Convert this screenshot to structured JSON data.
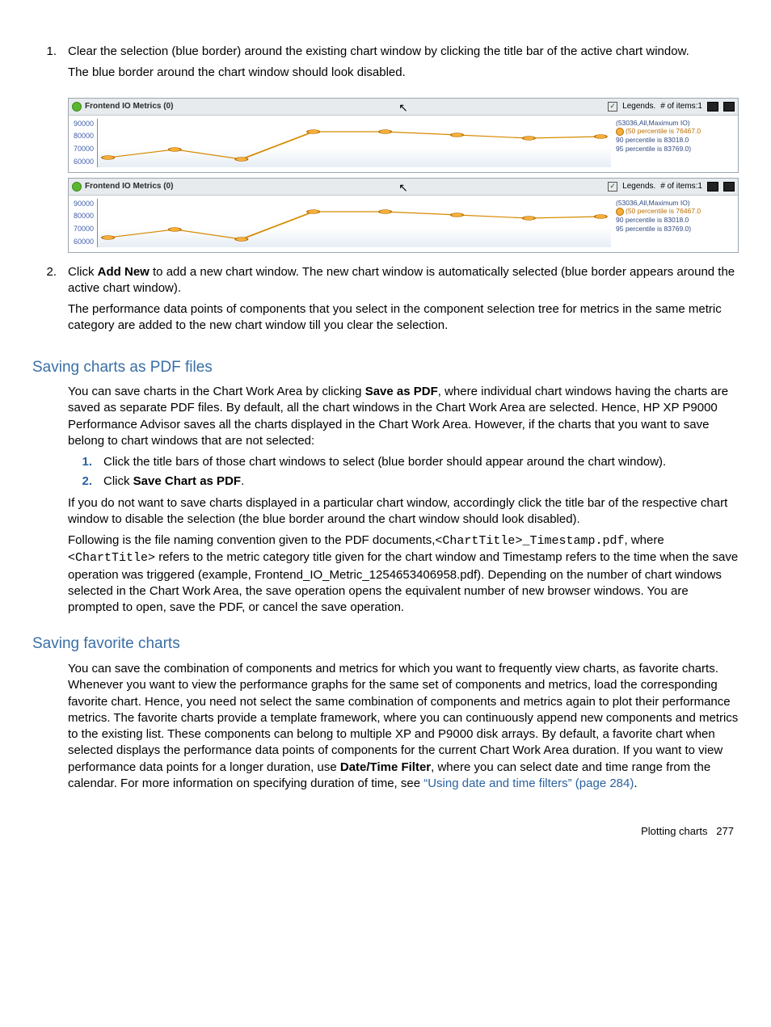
{
  "step1": {
    "num": "1.",
    "text": "Clear the selection (blue border) around the existing chart window by clicking the title bar of the active chart window.",
    "text2": "The blue border around the chart window should look disabled."
  },
  "chart_windows": [
    {
      "title": "Frontend IO Metrics (0)",
      "legends_label": "Legends.",
      "items_label": "# of items:1",
      "y_ticks": [
        "90000",
        "80000",
        "70000",
        "60000"
      ],
      "legend": {
        "series": "(53036,All,Maximum IO)",
        "p50": "(50 percentile is 76467.0",
        "p90": "90 percentile is 83018.0",
        "p95": "95 percentile is 83769.0)"
      }
    },
    {
      "title": "Frontend IO Metrics (0)",
      "legends_label": "Legends.",
      "items_label": "# of items:1",
      "y_ticks": [
        "90000",
        "80000",
        "70000",
        "60000"
      ],
      "legend": {
        "series": "(53036,All,Maximum IO)",
        "p50": "(50 percentile is 76467.0",
        "p90": "90 percentile is 83018.0",
        "p95": "95 percentile is 83769.0)"
      }
    }
  ],
  "step2": {
    "num": "2.",
    "text_before": "Click ",
    "bold": "Add New",
    "text_after": " to add a new chart window. The new chart window is automatically selected (blue border appears around the active chart window).",
    "text2": "The performance data points of components that you select in the component selection tree for metrics in the same metric category are added to the new chart window till you clear the selection."
  },
  "pdf_section": {
    "heading": "Saving charts as PDF files",
    "p1_a": "You can save charts in the Chart Work Area by clicking ",
    "p1_bold": "Save as PDF",
    "p1_b": ", where individual chart windows having the charts are saved as separate PDF files. By default, all the chart windows in the Chart Work Area are selected. Hence, HP XP P9000 Performance Advisor saves all the charts displayed in the Chart Work Area. However, if the charts that you want to save belong to chart windows that are not selected:",
    "li1": {
      "num": "1.",
      "text": "Click the title bars of those chart windows to select (blue border should appear around the chart window)."
    },
    "li2": {
      "num": "2.",
      "text_a": "Click ",
      "bold": "Save Chart as PDF",
      "text_b": "."
    },
    "p3": "If you do not want to save charts displayed in a particular chart window, accordingly click the title bar of the respective chart window to disable the selection (the blue border around the chart window should look disabled).",
    "p4_a": "Following is the file naming convention given to the PDF documents,",
    "p4_code1": "<ChartTitle>_Timestamp.pdf",
    "p4_b": ", where ",
    "p4_code2": "<ChartTitle>",
    "p4_c": " refers to the metric category title given for the chart window and Timestamp refers to the time when the save operation was triggered (example, Frontend_IO_Metric_1254653406958.pdf). Depending on the number of chart windows selected in the Chart Work Area, the save operation opens the equivalent number of new browser windows. You are prompted to open, save the PDF, or cancel the save operation."
  },
  "fav_section": {
    "heading": "Saving favorite charts",
    "p1_a": "You can save the combination of components and metrics for which you want to frequently view charts, as favorite charts. Whenever you want to view the performance graphs for the same set of components and metrics, load the corresponding favorite chart. Hence, you need not select the same combination of components and metrics again to plot their performance metrics. The favorite charts provide a template framework, where you can continuously append new components and metrics to the existing list. These components can belong to multiple XP and P9000 disk arrays. By default, a favorite chart when selected displays the performance data points of components for the current Chart Work Area duration. If you want to view performance data points for a longer duration, use ",
    "p1_bold": "Date/Time Filter",
    "p1_b": ", where you can select date and time range from the calendar. For more information on specifying duration of time, see ",
    "p1_link": "“Using date and time filters” (page 284)",
    "p1_c": "."
  },
  "footer": {
    "label": "Plotting charts",
    "page": "277"
  },
  "chart_data": [
    {
      "type": "line",
      "title": "Frontend IO Metrics (0)",
      "ylim": [
        60000,
        90000
      ],
      "x": [
        0,
        1,
        2,
        3,
        4,
        5,
        6,
        7
      ],
      "series": [
        {
          "name": "(53036,All,Maximum IO)",
          "values": [
            66000,
            71000,
            65000,
            82000,
            82000,
            80000,
            78000,
            79000
          ]
        }
      ],
      "annotations": {
        "50_percentile": 76467.0,
        "90_percentile": 83018.0,
        "95_percentile": 83769.0
      }
    },
    {
      "type": "line",
      "title": "Frontend IO Metrics (0)",
      "ylim": [
        60000,
        90000
      ],
      "x": [
        0,
        1,
        2,
        3,
        4,
        5,
        6,
        7
      ],
      "series": [
        {
          "name": "(53036,All,Maximum IO)",
          "values": [
            66000,
            71000,
            65000,
            82000,
            82000,
            80000,
            78000,
            79000
          ]
        }
      ],
      "annotations": {
        "50_percentile": 76467.0,
        "90_percentile": 83018.0,
        "95_percentile": 83769.0
      }
    }
  ]
}
